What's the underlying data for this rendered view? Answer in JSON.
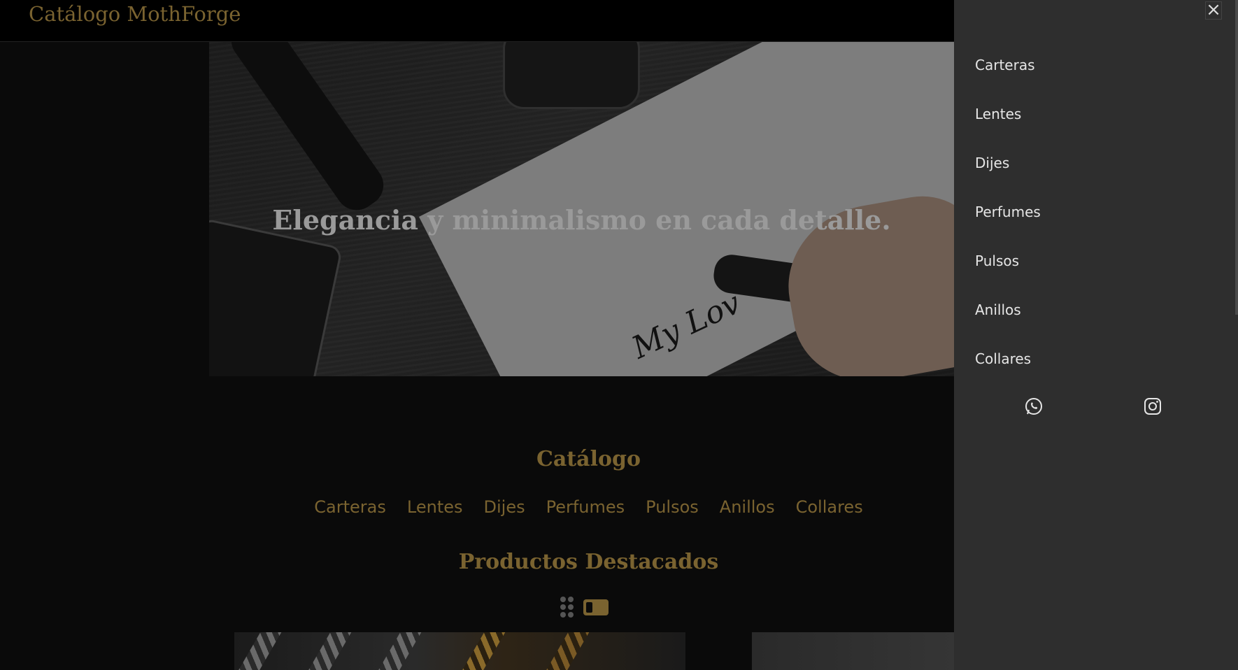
{
  "header": {
    "brand": "Catálogo MothForge"
  },
  "hero": {
    "headline": "Elegancia y minimalismo en cada detalle.",
    "signature": "My Lov"
  },
  "catalog": {
    "title": "Catálogo",
    "categories": [
      "Carteras",
      "Lentes",
      "Dijes",
      "Perfumes",
      "Pulsos",
      "Anillos",
      "Collares"
    ]
  },
  "featured": {
    "title": "Productos Destacados"
  },
  "drawer": {
    "close_label": "×",
    "menu": [
      "Carteras",
      "Lentes",
      "Dijes",
      "Perfumes",
      "Pulsos",
      "Anillos",
      "Collares"
    ],
    "social": [
      {
        "icon": "whatsapp-icon"
      },
      {
        "icon": "instagram-icon"
      }
    ]
  },
  "colors": {
    "accent": "#7a6330",
    "drawer_bg": "#2e2e2e",
    "page_bg": "#0a0a0a"
  }
}
